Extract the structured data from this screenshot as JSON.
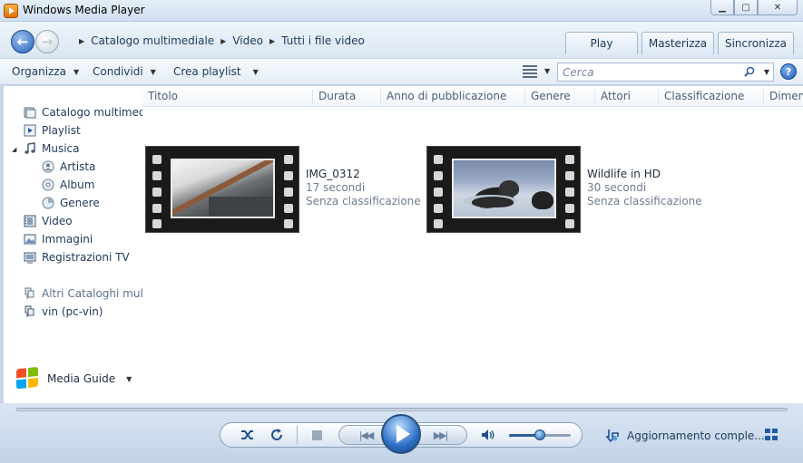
{
  "window": {
    "title": "Windows Media Player"
  },
  "nav": {
    "breadcrumb": [
      "Catalogo multimediale",
      "Video",
      "Tutti i file video"
    ],
    "tabs": [
      "Play",
      "Masterizza",
      "Sincronizza"
    ]
  },
  "toolbar": {
    "organize": "Organizza",
    "share": "Condividi",
    "create_playlist": "Crea playlist",
    "search_placeholder": "Cerca"
  },
  "sidebar": {
    "items": [
      {
        "label": "Catalogo multimedi",
        "icon": "library-icon"
      },
      {
        "label": "Playlist",
        "icon": "playlist-icon"
      },
      {
        "label": "Musica",
        "icon": "music-icon"
      },
      {
        "label": "Artista",
        "icon": "artist-icon"
      },
      {
        "label": "Album",
        "icon": "album-icon"
      },
      {
        "label": "Genere",
        "icon": "genre-icon"
      },
      {
        "label": "Video",
        "icon": "video-icon"
      },
      {
        "label": "Immagini",
        "icon": "pictures-icon"
      },
      {
        "label": "Registrazioni TV",
        "icon": "tv-icon"
      },
      {
        "label": "Altri Cataloghi multi",
        "icon": "network-library-icon"
      },
      {
        "label": "vin (pc-vin)",
        "icon": "network-library-icon"
      }
    ],
    "media_guide": "Media Guide"
  },
  "columns": [
    "Titolo",
    "Durata",
    "Anno di pubblicazione",
    "Genere",
    "Attori",
    "Classificazione",
    "Dimen"
  ],
  "videos": [
    {
      "title": "IMG_0312",
      "duration": "17 secondi",
      "rating": "Senza classificazione"
    },
    {
      "title": "Wildlife in HD",
      "duration": "30 secondi",
      "rating": "Senza classificazione"
    }
  ],
  "player": {
    "status": "Aggiornamento comple...",
    "volume": 0.5
  },
  "colors": {
    "accent": "#1d4f91",
    "background": "#c6d7ea"
  }
}
